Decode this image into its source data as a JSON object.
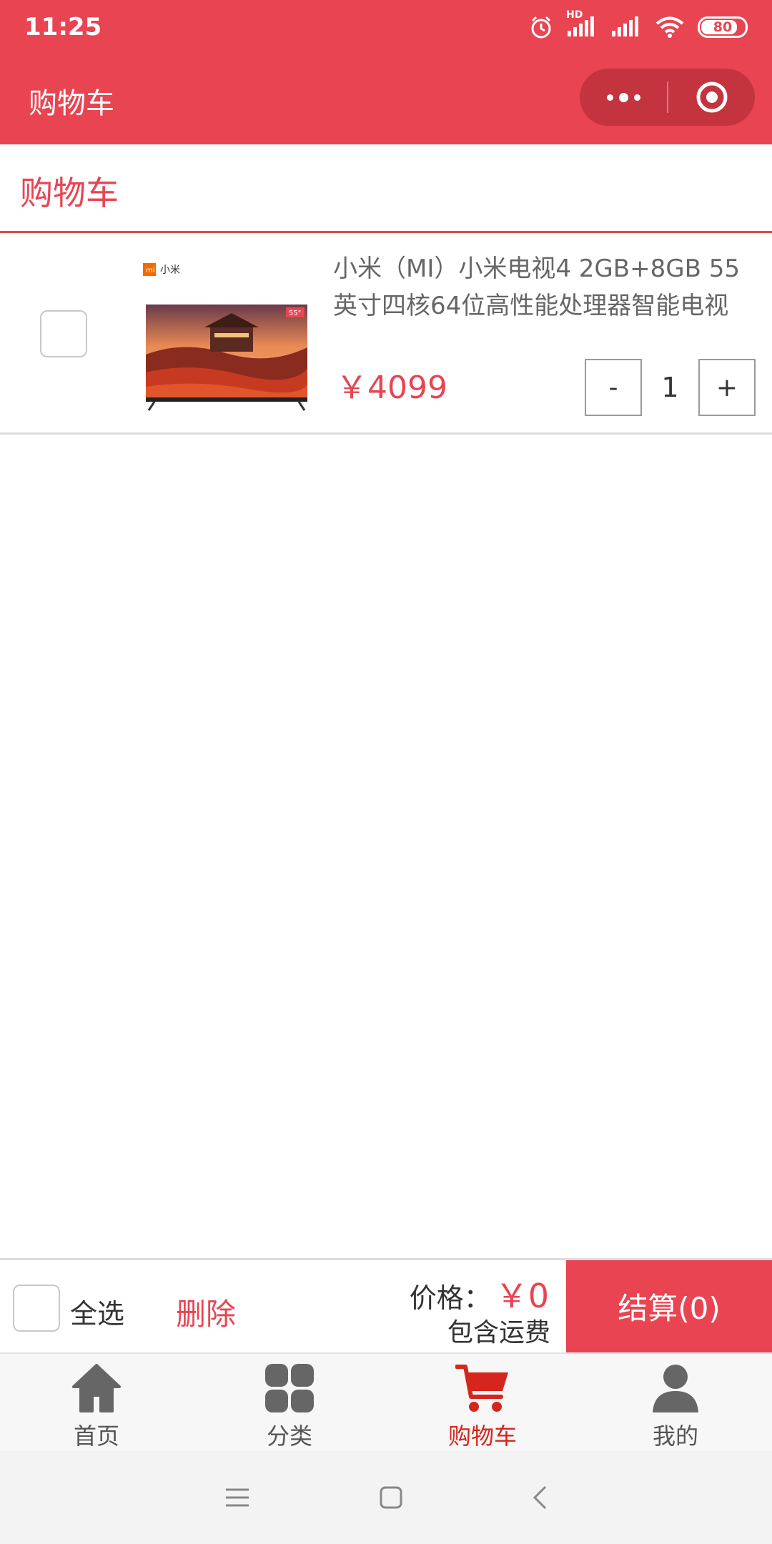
{
  "status_bar": {
    "time": "11:25",
    "network_label": "HD",
    "battery": "80"
  },
  "nav": {
    "title": "购物车"
  },
  "header": {
    "title": "购物车"
  },
  "cart": {
    "items": [
      {
        "title": "小米（MI）小米电视4 2GB+8GB 55英寸四核64位高性能处理器智能电视",
        "price": "￥4099",
        "quantity": "1",
        "brand_label": "小米",
        "size_badge": "55\"",
        "checked": false
      }
    ],
    "stepper": {
      "minus": "-",
      "plus": "+"
    }
  },
  "footer": {
    "select_all": "全选",
    "delete": "删除",
    "price_label": "价格：",
    "price_value": "￥0",
    "shipping": "包含运费",
    "checkout": "结算(0)"
  },
  "tabs": [
    {
      "label": "首页",
      "icon": "home-icon"
    },
    {
      "label": "分类",
      "icon": "grid-icon"
    },
    {
      "label": "购物车",
      "icon": "cart-icon",
      "active": true
    },
    {
      "label": "我的",
      "icon": "user-icon"
    }
  ],
  "colors": {
    "primary": "#e94452",
    "active_tab": "#d6251c",
    "inactive_tab": "#555555"
  }
}
